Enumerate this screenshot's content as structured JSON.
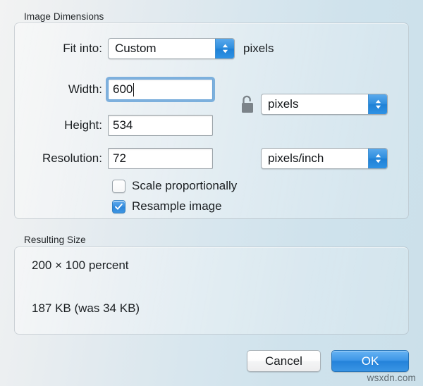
{
  "dialog": {
    "sections": {
      "image_dimensions": {
        "title": "Image Dimensions",
        "fit_into": {
          "label": "Fit into:",
          "value": "Custom",
          "unit_suffix": "pixels"
        },
        "width": {
          "label": "Width:",
          "value": "600",
          "focused": true
        },
        "height": {
          "label": "Height:",
          "value": "534"
        },
        "resolution": {
          "label": "Resolution:",
          "value": "72"
        },
        "size_unit": {
          "value": "pixels"
        },
        "resolution_unit": {
          "value": "pixels/inch"
        },
        "lock": {
          "state": "unlocked"
        },
        "scale_proportionally": {
          "label": "Scale proportionally",
          "checked": false
        },
        "resample_image": {
          "label": "Resample image",
          "checked": true
        }
      },
      "resulting_size": {
        "title": "Resulting Size",
        "percent_line": "200 × 100 percent",
        "bytes_line": "187 KB (was 34 KB)"
      }
    },
    "buttons": {
      "cancel": "Cancel",
      "ok": "OK"
    }
  },
  "watermark": "wsxdn.com",
  "colors": {
    "accent_blue": "#3a8fdf",
    "focus_ring": "#6aa4d8",
    "default_button_blue": "#2482da",
    "lock_gray": "#7b8389",
    "text": "#1b1f22"
  }
}
